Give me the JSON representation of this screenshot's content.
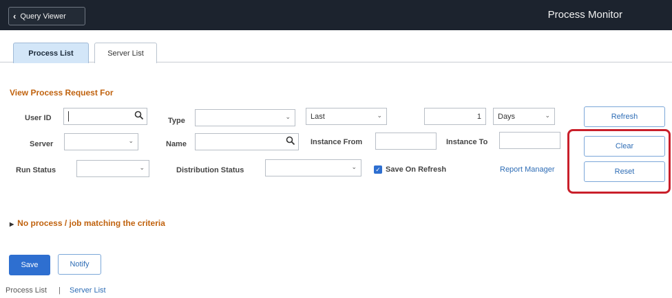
{
  "header": {
    "back_label": "Query Viewer",
    "title": "Process Monitor"
  },
  "tabs": [
    {
      "label": "Process List",
      "active": true
    },
    {
      "label": "Server List",
      "active": false
    }
  ],
  "form": {
    "section_title": "View Process Request For",
    "user_id": {
      "label": "User ID",
      "value": ""
    },
    "type": {
      "label": "Type",
      "value": ""
    },
    "period": {
      "value": "Last"
    },
    "count": {
      "value": "1"
    },
    "unit": {
      "value": "Days"
    },
    "server": {
      "label": "Server",
      "value": ""
    },
    "name": {
      "label": "Name",
      "value": ""
    },
    "instance_from": {
      "label": "Instance From",
      "value": ""
    },
    "instance_to": {
      "label": "Instance To",
      "value": ""
    },
    "run_status": {
      "label": "Run Status",
      "value": ""
    },
    "distribution_status": {
      "label": "Distribution Status",
      "value": ""
    },
    "save_on_refresh": {
      "label": "Save On Refresh",
      "checked": true
    },
    "report_manager": "Report Manager"
  },
  "buttons": {
    "refresh": "Refresh",
    "clear": "Clear",
    "reset": "Reset",
    "save": "Save",
    "notify": "Notify"
  },
  "results": {
    "message": "No process / job matching the criteria"
  },
  "footer": {
    "links": [
      "Process List",
      "Server List"
    ],
    "separator": "|"
  },
  "colors": {
    "header_bg": "#1c232e",
    "accent_orange": "#c0620e",
    "link_blue": "#2d6cb5",
    "primary_button": "#2e6fd0",
    "highlight_red": "#c91f2a"
  }
}
